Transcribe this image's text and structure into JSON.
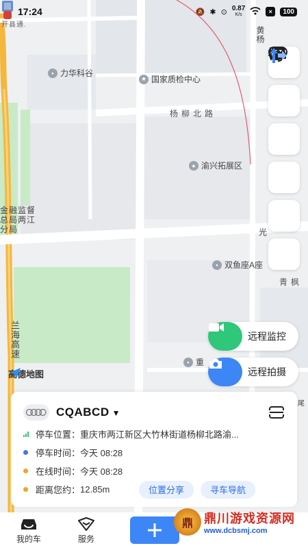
{
  "status_bar": {
    "time": "17:24",
    "speed": "0.87",
    "speed_unit": "K/s",
    "battery": "100"
  },
  "map": {
    "labels": {
      "top_left": "开县通.",
      "poi_lihua": "力华科谷",
      "poi_zhijian": "国家质检中心",
      "road_yangliu": "杨柳北路",
      "poi_yuxing": "渝兴拓展区",
      "poi_finance_1": "金融监督",
      "poi_finance_2": "总局两江",
      "poi_finance_3": "分局",
      "poi_shuangyu": "双鱼座A座",
      "road_qingfeng": "青枫",
      "road_xingguang": "星光",
      "road_huangyang": "黄杨",
      "highway": "兰海高速",
      "poi_chong": "重",
      "road_guang": "光",
      "road_tail": "前尾"
    },
    "attribution": "高德地图"
  },
  "tools": [
    "message-icon",
    "more-icon",
    "satellite-icon",
    "car-icon",
    "eye-icon",
    "direction-icon"
  ],
  "remote": {
    "monitor": "远程监控",
    "photo": "远程拍摄"
  },
  "card": {
    "plate": "CQABCD",
    "rows": [
      {
        "key": "停车位置：",
        "value": "重庆市两江新区大竹林街道杨柳北路渝..."
      },
      {
        "key": "停车时间：",
        "value": "今天 08:28"
      },
      {
        "key": "在线时间：",
        "value": "今天 08:28"
      },
      {
        "key": "距离您约：",
        "value": "12.85m"
      }
    ],
    "share": "位置分享",
    "navigate": "寻车导航"
  },
  "nav": {
    "my_car": "我的车",
    "service": "服务"
  },
  "watermark": {
    "title": "鼎川游戏资源网",
    "url": "www.dcbsmj.com",
    "seal": "鼎"
  },
  "colors": {
    "accent": "#3d86f6",
    "green": "#2fc77a",
    "dot_blue": "#3d7be0",
    "dot_orange": "#f0a52a"
  }
}
